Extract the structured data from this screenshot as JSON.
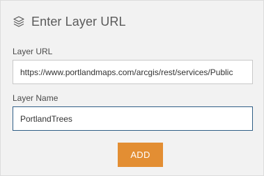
{
  "header": {
    "title": "Enter Layer URL",
    "icon": "layers-icon"
  },
  "url_field": {
    "label": "Layer URL",
    "value": "https://www.portlandmaps.com/arcgis/rest/services/Public"
  },
  "name_field": {
    "label": "Layer Name",
    "value": "PortlandTrees"
  },
  "actions": {
    "add_label": "ADD"
  },
  "colors": {
    "accent": "#e38e33",
    "focus_border": "#2f5e86",
    "background": "#f2f2f2"
  }
}
